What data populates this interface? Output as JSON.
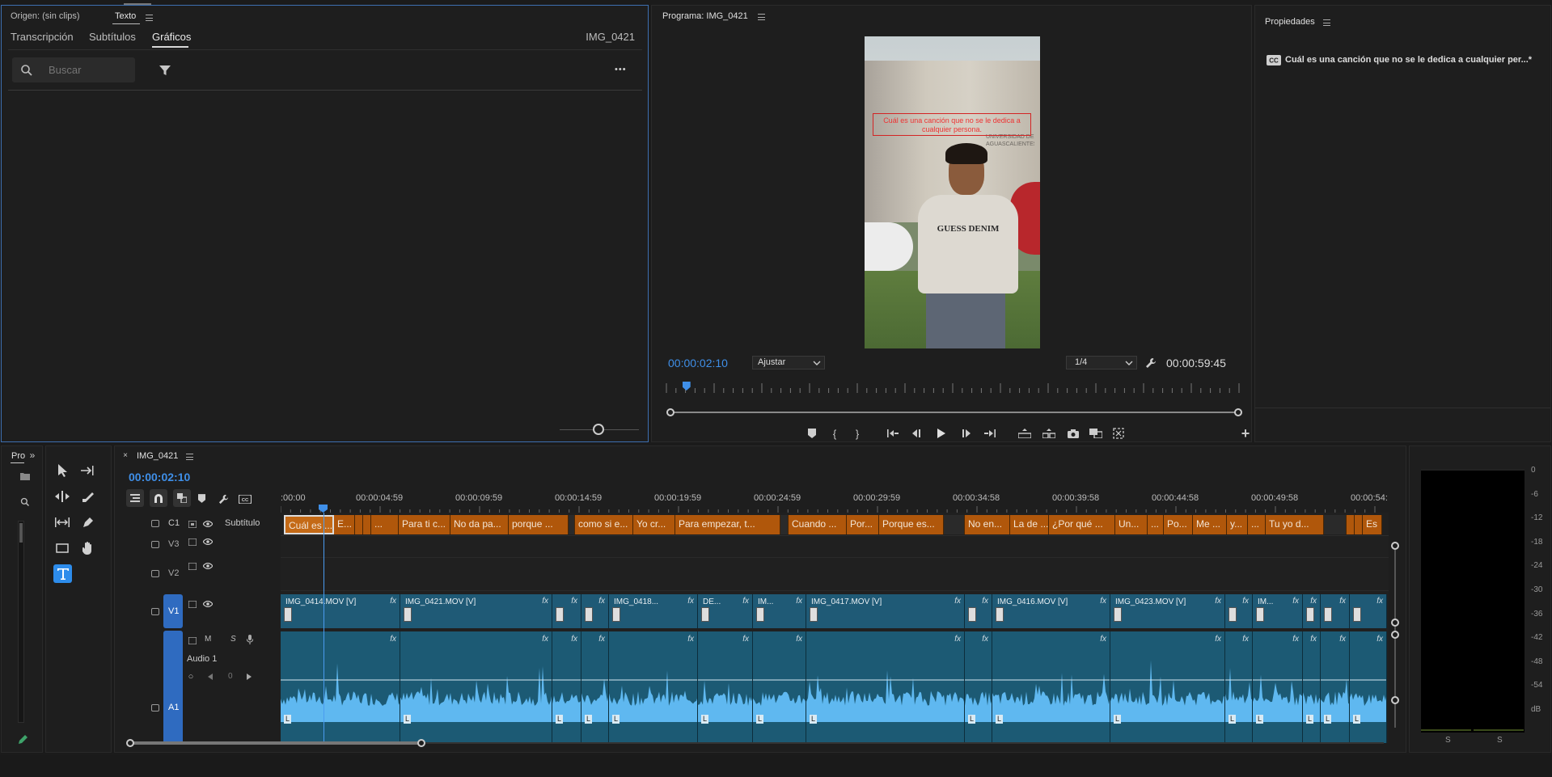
{
  "source_panel": {
    "header_label": "Origen: (sin clips)",
    "active_tab": "Texto",
    "subtabs": [
      "Transcripción",
      "Subtítulos",
      "Gráficos"
    ],
    "active_subtab": "Gráficos",
    "sequence_name": "IMG_0421",
    "search_placeholder": "Buscar",
    "more_label": "•••"
  },
  "program_monitor": {
    "title": "Programa: IMG_0421",
    "caption_text": "Cuál es una canción que no se le dedica a cualquier persona.",
    "current_time": "00:00:02:10",
    "fit_option": "Ajustar",
    "resolution": "1/4",
    "duration": "00:00:59:45",
    "playhead_fraction": 0.04,
    "shirt_text": "GUESS DENIM",
    "sign_text": "UNIVERSIDAD DE AGUASCALIENTES"
  },
  "properties_panel": {
    "title": "Propiedades",
    "caption_line": "Cuál es una canción que no se  le dedica a cualquier per...*"
  },
  "project_panel": {
    "tab_label": "Pro"
  },
  "timeline": {
    "sequence_name": "IMG_0421",
    "current_time": "00:00:02:10",
    "ruler": [
      ":00:00",
      "00:00:04:59",
      "00:00:09:59",
      "00:00:14:59",
      "00:00:19:59",
      "00:00:24:59",
      "00:00:29:59",
      "00:00:34:58",
      "00:00:39:58",
      "00:00:44:58",
      "00:00:49:58",
      "00:00:54:"
    ],
    "tracks": {
      "c1": {
        "id": "C1",
        "name": "Subtítulo"
      },
      "v3": {
        "id": "V3"
      },
      "v2": {
        "id": "V2"
      },
      "v1": {
        "id": "V1"
      },
      "a1": {
        "id": "A1",
        "name": "Audio 1",
        "m": "M",
        "s": "S",
        "vol": "0"
      }
    },
    "captions": [
      "Cuál es ...",
      "E...",
      "",
      "",
      "...",
      "Para ti c...",
      "No da pa...",
      "porque ...",
      "",
      "como si e...",
      "Yo cr...",
      "Para empezar, t...",
      "",
      "Cuando ...",
      "Por...",
      "Porque es...",
      "",
      "No en...",
      "La de ...",
      "¿Por qué ...",
      "Un...",
      "...",
      "Po...",
      "Me ...",
      "y...",
      "...",
      "Tu yo d...",
      "",
      "",
      "",
      "Es"
    ],
    "video_clips": [
      "IMG_0414.MOV [V]",
      "IMG_0421.MOV [V]",
      "",
      "",
      "IMG_0418...",
      "DE...",
      "IM...",
      "IMG_0417.MOV [V]",
      "",
      "IMG_0416.MOV [V]",
      "IMG_0423.MOV [V]",
      "",
      "IM...",
      "",
      "",
      ""
    ],
    "fx_label": "fx",
    "clip_marker": "L"
  },
  "audio_meter": {
    "scale": [
      "0",
      "-6",
      "-12",
      "-18",
      "-24",
      "-30",
      "-36",
      "-42",
      "-48",
      "-54",
      "dB"
    ],
    "solo": [
      "S",
      "S"
    ]
  },
  "colors": {
    "accent": "#3f8fe8",
    "caption_clip": "#b0570b",
    "video_clip": "#1f5a76",
    "audio_wave": "#5fb8f0"
  }
}
